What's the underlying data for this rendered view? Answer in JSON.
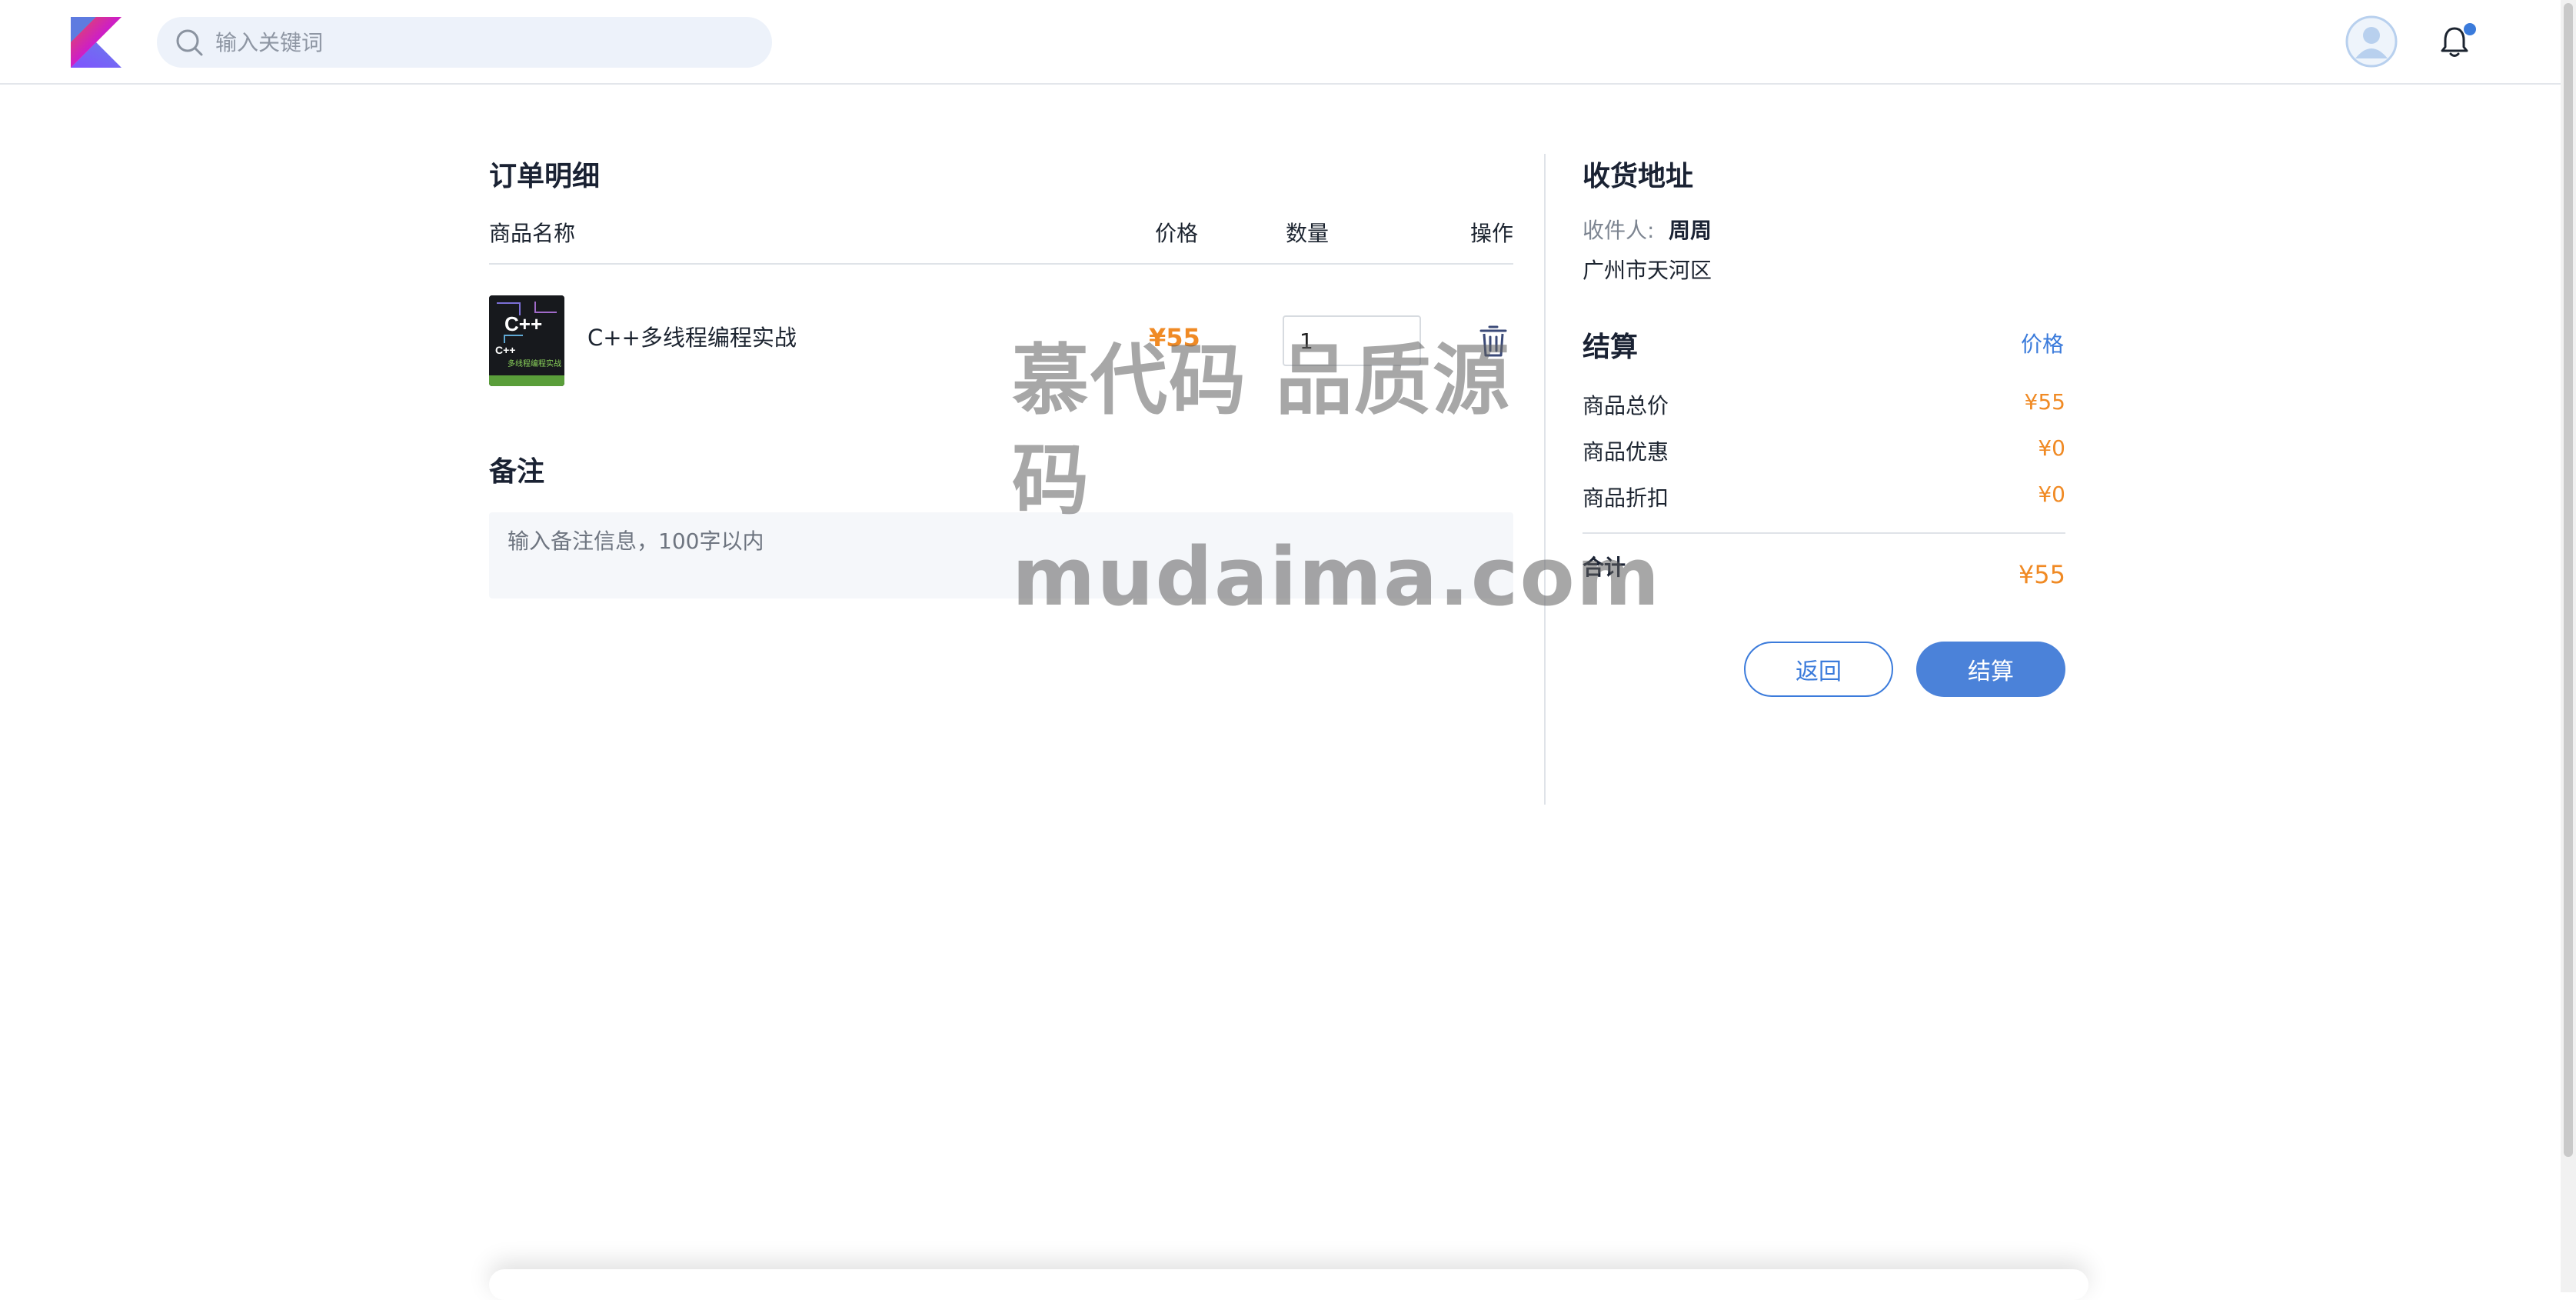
{
  "header": {
    "logo_icon": "kotlin-logo-icon",
    "search": {
      "placeholder": "输入关键词",
      "value": ""
    },
    "avatar_icon": "user-avatar-icon",
    "bell_icon": "bell-icon"
  },
  "order": {
    "title": "订单明细",
    "columns": {
      "name": "商品名称",
      "price": "价格",
      "quantity": "数量",
      "action": "操作"
    },
    "items": [
      {
        "name": "C++多线程编程实战",
        "price": "¥55",
        "quantity": "1",
        "cover_title": "C++",
        "cover_subtitle": "C++",
        "cover_caption": "多线程编程实战",
        "delete_icon": "trash-icon"
      }
    ]
  },
  "remark": {
    "title": "备注",
    "placeholder": "输入备注信息，100字以内"
  },
  "address": {
    "title": "收货地址",
    "recipient_label": "收件人:",
    "recipient_name": "周周",
    "location": "广州市天河区"
  },
  "checkout": {
    "title": "结算",
    "price_link": "价格",
    "rows": [
      {
        "label": "商品总价",
        "value": "¥55"
      },
      {
        "label": "商品优惠",
        "value": "¥0"
      },
      {
        "label": "商品折扣",
        "value": "¥0"
      }
    ],
    "total_label": "合计",
    "total_value": "¥55",
    "back_button": "返回",
    "submit_button": "结算"
  },
  "watermark": {
    "line1": "慕代码 品质源码",
    "line2": "mudaima.com"
  },
  "colors": {
    "accent_blue": "#3b7bdb",
    "price_orange": "#f08a24",
    "search_bg": "#edf2fa"
  }
}
